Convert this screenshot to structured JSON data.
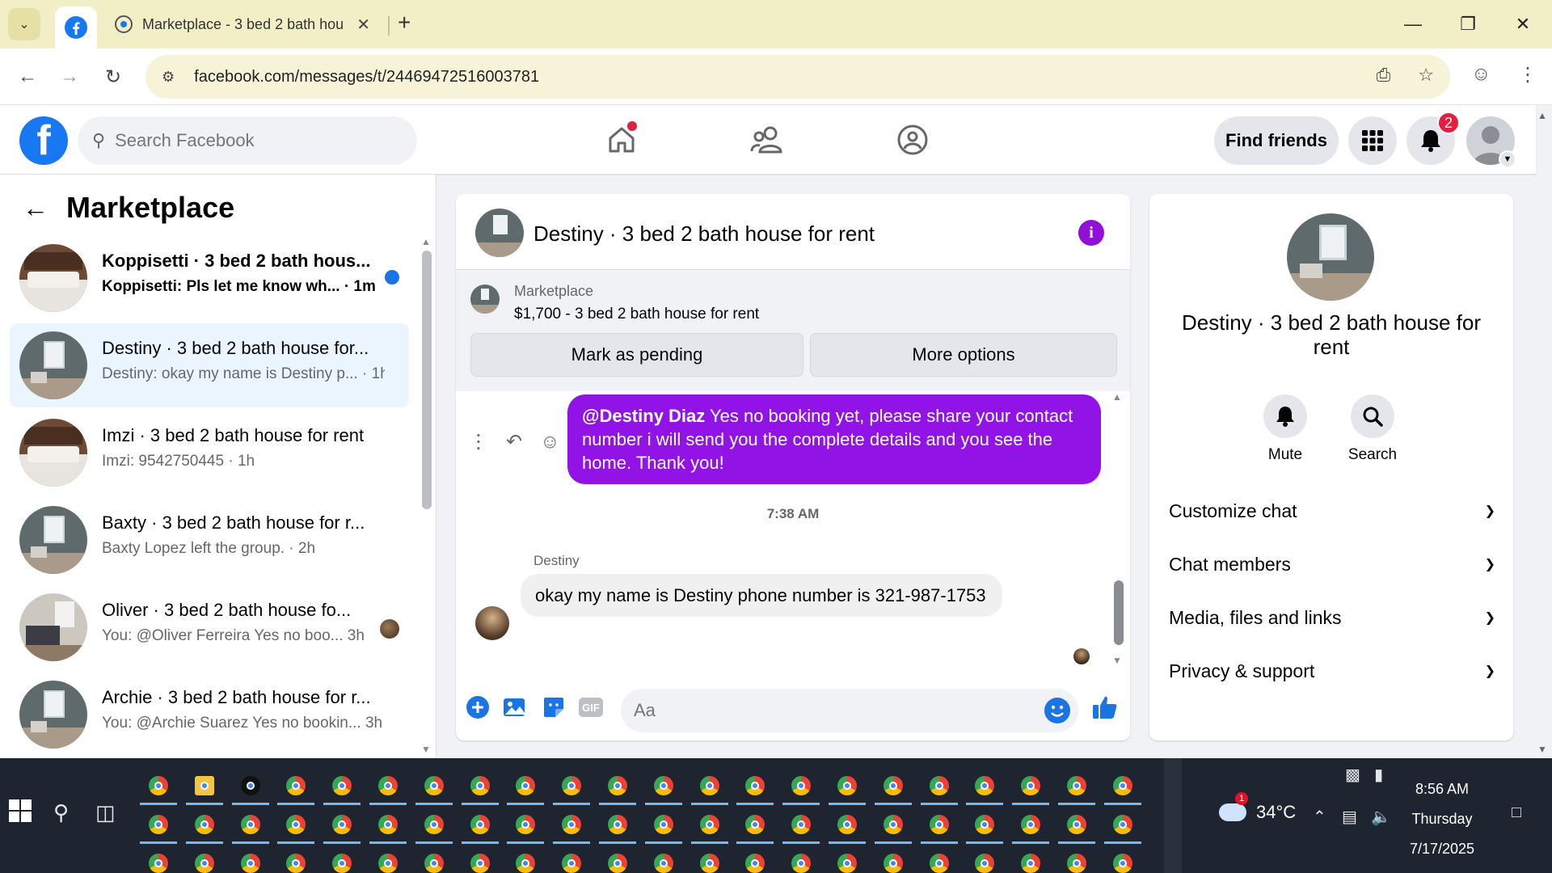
{
  "browser": {
    "tab_title": "Marketplace - 3 bed 2 bath hou",
    "url": "facebook.com/messages/t/24469472516003781"
  },
  "fb": {
    "search_placeholder": "Search Facebook",
    "find_friends": "Find friends",
    "notif_count": "2"
  },
  "left": {
    "title": "Marketplace",
    "chats": [
      {
        "title": "Koppisetti · 3 bed 2 bath hous...",
        "snippet": "Koppisetti: Pls let me know wh... · 1m",
        "unread": true
      },
      {
        "title": "Destiny · 3 bed 2 bath house for...",
        "snippet": "Destiny: okay my name is Destiny p... · 1h",
        "active": true
      },
      {
        "title": "Imzi · 3 bed 2 bath house for rent",
        "snippet": "Imzi: 9542750445 · 1h"
      },
      {
        "title": "Baxty · 3 bed 2 bath house for r...",
        "snippet": "Baxty Lopez left the group. · 2h"
      },
      {
        "title": "Oliver · 3 bed 2 bath house fo...",
        "snippet": "You: @Oliver Ferreira Yes no boo... 3h"
      },
      {
        "title": "Archie · 3 bed 2 bath house for r...",
        "snippet": "You: @Archie Suarez Yes no bookin... 3h"
      }
    ]
  },
  "conversation": {
    "title": "Destiny · 3 bed 2 bath house for rent",
    "marketplace_label": "Marketplace",
    "listing": "$1,700 - 3 bed 2 bath house for rent",
    "mark_pending": "Mark as pending",
    "more_options": "More options",
    "out_mention": "@Destiny Diaz",
    "out_text": " Yes no booking yet, please share your contact number i will send you the complete details and you see the home. Thank you!",
    "timestamp": "7:38 AM",
    "sender": "Destiny",
    "in_text": "okay my name is Destiny phone number is 321-987-1753",
    "composer_placeholder": "Aa"
  },
  "info_panel": {
    "title": "Destiny · 3 bed 2 bath house for rent",
    "mute": "Mute",
    "search": "Search",
    "sections": [
      "Customize chat",
      "Chat members",
      "Media, files and links",
      "Privacy & support"
    ]
  },
  "taskbar": {
    "temperature": "34°C",
    "weather_badge": "1",
    "time": "8:56 AM",
    "day": "Thursday",
    "date": "7/17/2025"
  }
}
